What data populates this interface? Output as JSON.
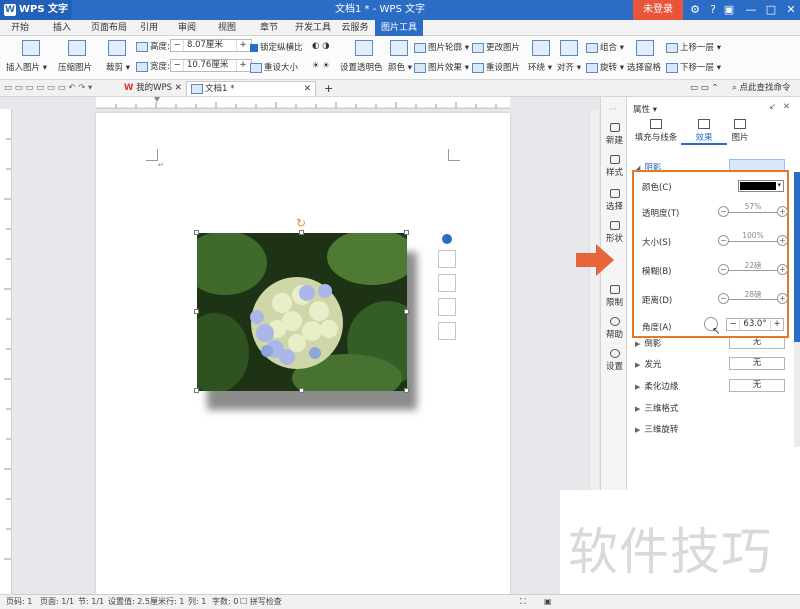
{
  "window": {
    "app_name": "WPS 文字",
    "title": "文档1 * - WPS 文字",
    "login_label": "未登录"
  },
  "ribbon_tabs": [
    {
      "label": "开始"
    },
    {
      "label": "插入"
    },
    {
      "label": "页面布局"
    },
    {
      "label": "引用"
    },
    {
      "label": "审阅"
    },
    {
      "label": "视图"
    },
    {
      "label": "章节"
    },
    {
      "label": "开发工具"
    },
    {
      "label": "云服务"
    },
    {
      "label": "图片工具"
    }
  ],
  "ribbon": {
    "insert_image": "插入图片",
    "compress_image": "压缩图片",
    "crop": "裁剪",
    "height_label": "高度:",
    "height_value": "8.07厘米",
    "width_label": "宽度:",
    "width_value": "10.76厘米",
    "lock_ratio": "锁定纵横比",
    "reset_size": "重设大小",
    "set_transparent": "设置透明色",
    "color": "颜色",
    "image_outline": "图片轮廓",
    "image_effects": "图片效果",
    "change_image": "更改图片",
    "reset_image": "重设图片",
    "wrap": "环绕",
    "align": "对齐",
    "group": "组合",
    "rotate": "旋转",
    "selection_pane": "选择窗格",
    "bring_forward": "上移一层",
    "send_backward": "下移一层"
  },
  "doc_tabs": {
    "my_wps": "我的WPS",
    "doc1": "文档1 *",
    "add": "+",
    "search": "点此查找命令"
  },
  "sidebar": {
    "items": [
      {
        "label": "新建"
      },
      {
        "label": "样式"
      },
      {
        "label": "选择"
      },
      {
        "label": "形状"
      },
      {
        "label": "限制"
      },
      {
        "label": "帮助"
      },
      {
        "label": "设置"
      }
    ]
  },
  "panel": {
    "header": "属性",
    "tabs": [
      {
        "label": "填充与线条"
      },
      {
        "label": "效果"
      },
      {
        "label": "图片"
      }
    ],
    "shadow_section": "阴影",
    "color_label": "颜色(C)",
    "shadow_color": "#000000",
    "transparency_label": "透明度(T)",
    "transparency_value": "57%",
    "size_label": "大小(S)",
    "size_value": "100%",
    "blur_label": "模糊(B)",
    "blur_value": "22磅",
    "distance_label": "距离(D)",
    "distance_value": "28磅",
    "angle_label": "角度(A)",
    "angle_value": "63.0°",
    "reflection": "倒影",
    "reflection_value": "无",
    "glow": "发光",
    "glow_value": "无",
    "soft_edges": "柔化边缘",
    "soft_edges_value": "无",
    "format_3d": "三维格式",
    "rotation_3d": "三维旋转"
  },
  "status": {
    "page": "页码: 1",
    "pages": "页面: 1/1",
    "section": "节: 1/1",
    "setting": "设置值: 2.5厘米",
    "row": "行: 1",
    "col": "列: 1",
    "words": "字数: 0",
    "spell": "拼写检查"
  },
  "watermark": "软件技巧",
  "colors": {
    "accent": "#2b6cc4",
    "highlight": "#e07a2a",
    "login": "#e8553a"
  }
}
